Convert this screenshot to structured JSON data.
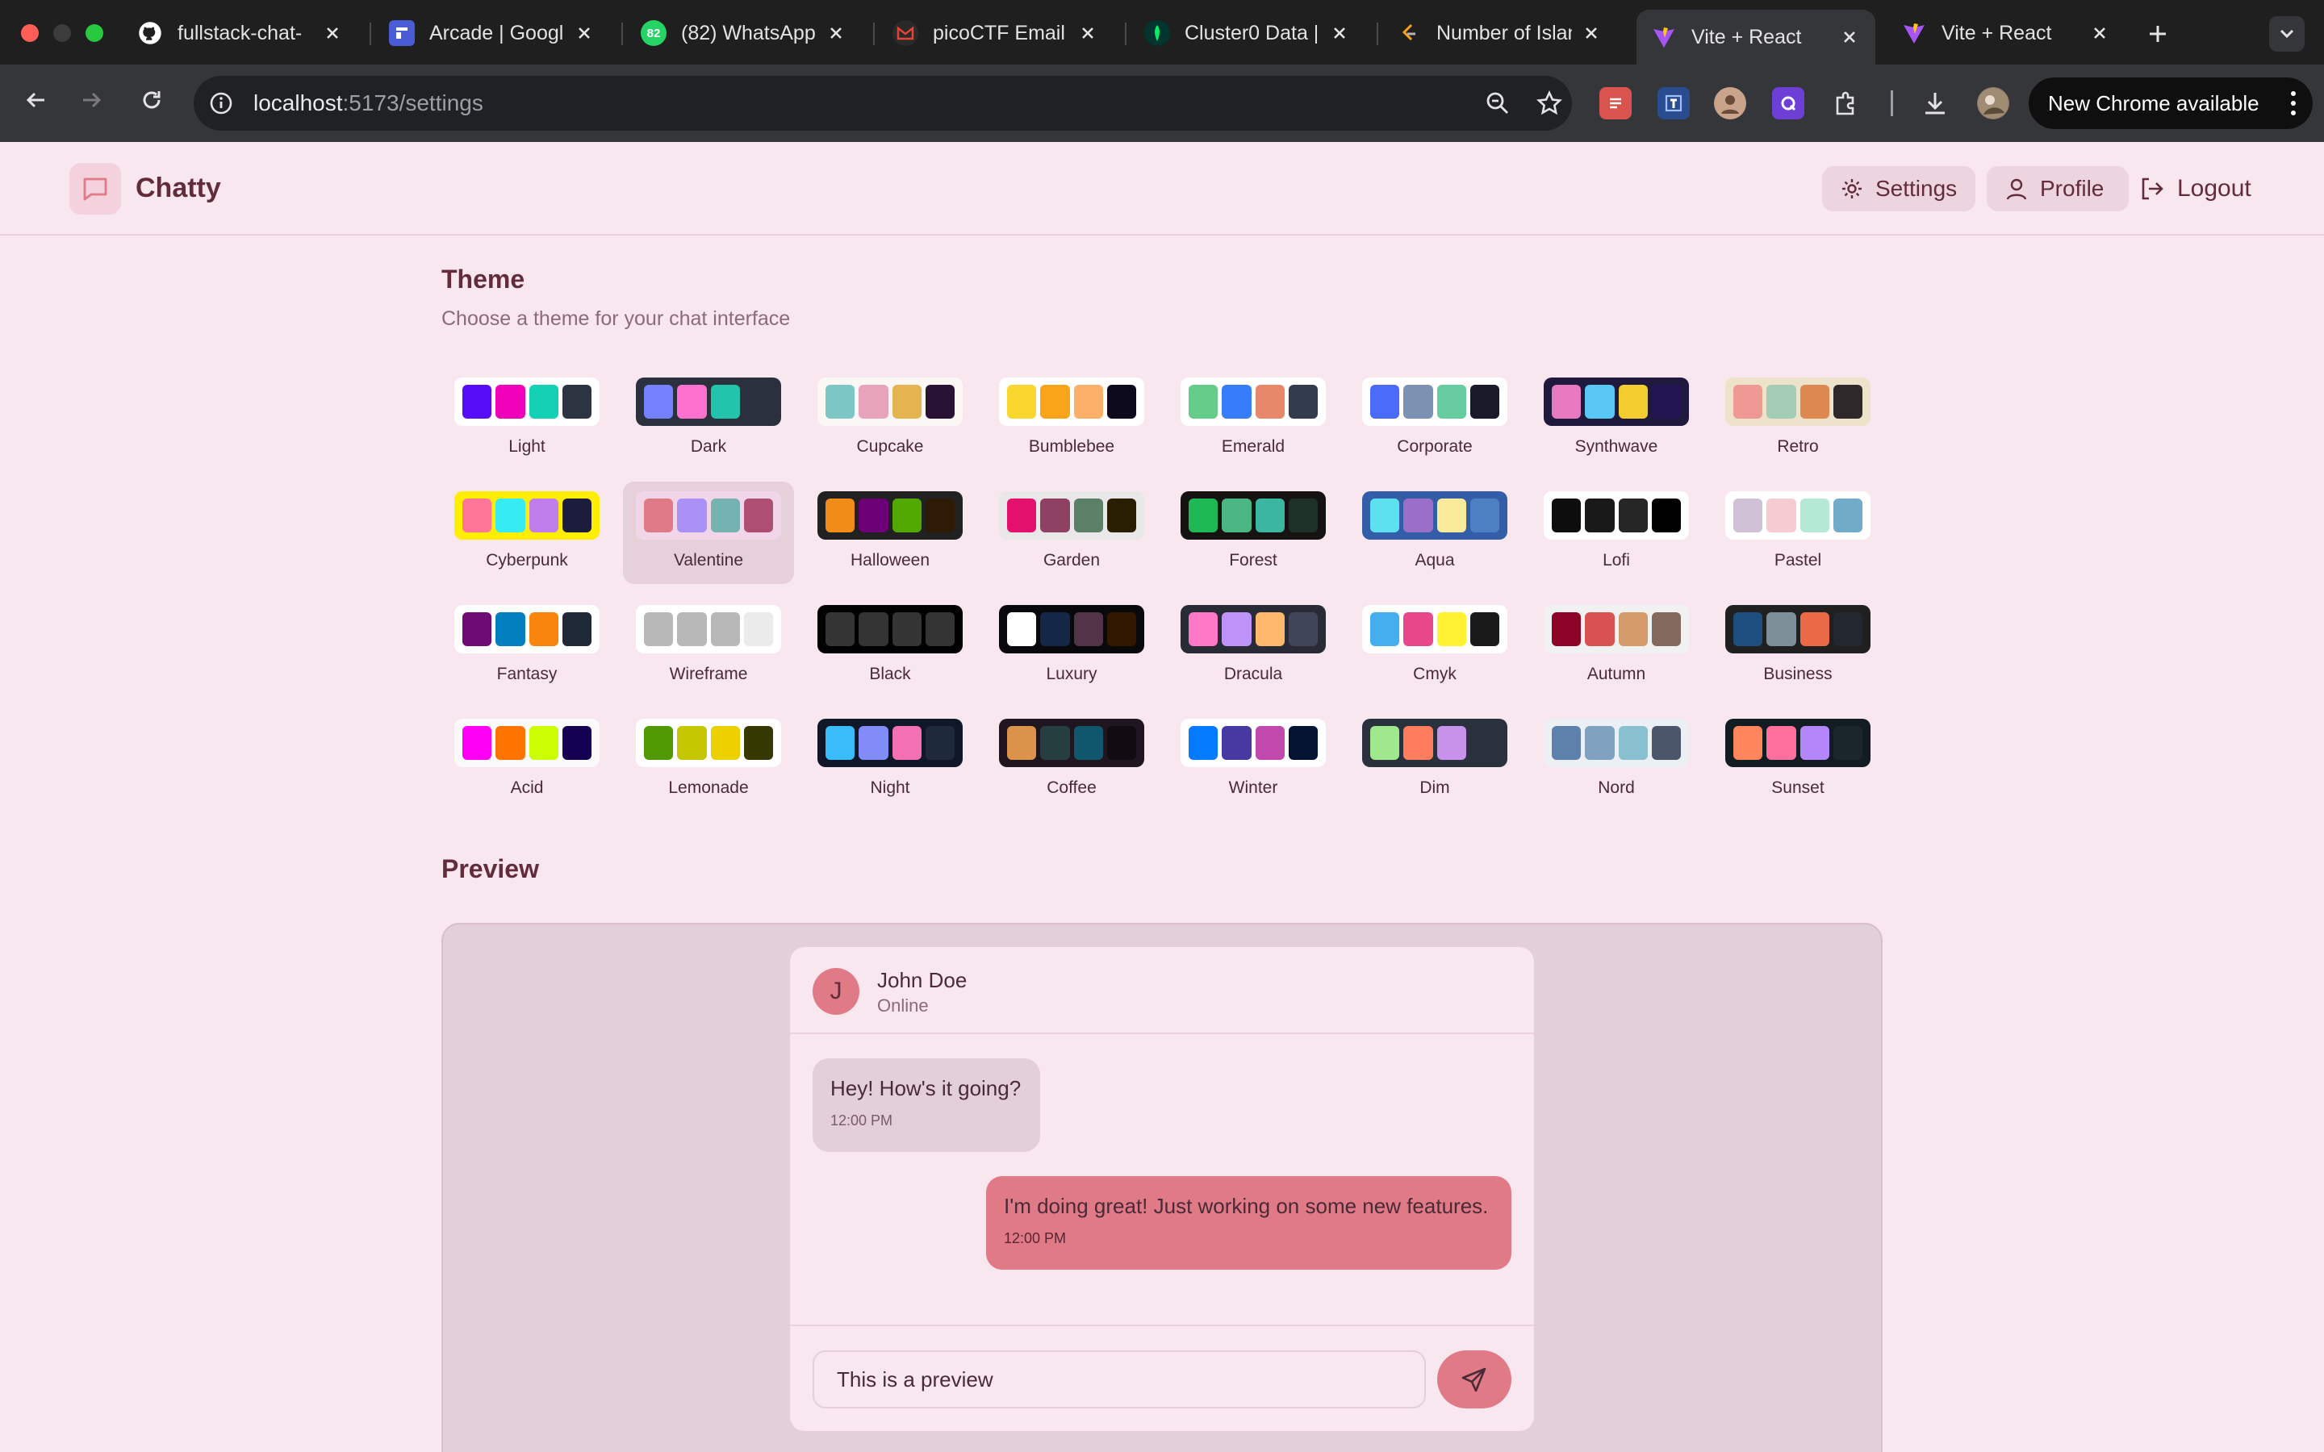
{
  "browser": {
    "tabs": [
      {
        "title": "fullstack-chat-",
        "icon": "github-icon",
        "favicon_color": "#1f1f1f"
      },
      {
        "title": "Arcade | Googl",
        "icon": "arcade-icon",
        "favicon_color": "#4a5bd6"
      },
      {
        "title": "(82) WhatsApp",
        "icon": "whatsapp-icon",
        "favicon_color": "#25d366",
        "badge": "82"
      },
      {
        "title": "picoCTF Email",
        "icon": "gmail-icon",
        "favicon_color": "#ea4335"
      },
      {
        "title": "Cluster0 Data |",
        "icon": "mongodb-icon",
        "favicon_color": "#00ed64"
      },
      {
        "title": "Number of Islan",
        "icon": "leetcode-icon",
        "favicon_color": "#ffa116"
      },
      {
        "title": "Vite + React",
        "icon": "vite-icon",
        "favicon_color": "#a855f7",
        "active": true
      },
      {
        "title": "Vite + React",
        "icon": "vite-icon",
        "favicon_color": "#a855f7"
      }
    ],
    "url_host": "localhost",
    "url_path": ":5173/settings",
    "update_label": "New Chrome available"
  },
  "app": {
    "name": "Chatty",
    "nav": {
      "settings": "Settings",
      "profile": "Profile",
      "logout": "Logout"
    }
  },
  "theme_section": {
    "title": "Theme",
    "subtitle": "Choose a theme for your chat interface",
    "selected": "Valentine",
    "themes": [
      {
        "name": "Light",
        "bg": "#ffffff",
        "colors": [
          "#570df8",
          "#f000b8",
          "#14d1b5",
          "#2b3440"
        ]
      },
      {
        "name": "Dark",
        "bg": "#2a303c",
        "colors": [
          "#7582ff",
          "#ff71cf",
          "#22c4ab",
          "#2a303c"
        ]
      },
      {
        "name": "Cupcake",
        "bg": "#faf7f5",
        "colors": [
          "#7cc6c6",
          "#e7a3ba",
          "#e5b451",
          "#291334"
        ]
      },
      {
        "name": "Bumblebee",
        "bg": "#ffffff",
        "colors": [
          "#f9d72f",
          "#faa41a",
          "#fdb06a",
          "#0d0a1e"
        ]
      },
      {
        "name": "Emerald",
        "bg": "#ffffff",
        "colors": [
          "#66cc8a",
          "#377cfb",
          "#e8886b",
          "#333c4d"
        ]
      },
      {
        "name": "Corporate",
        "bg": "#ffffff",
        "colors": [
          "#4b6bfb",
          "#7b92b2",
          "#67cba0",
          "#181a2a"
        ]
      },
      {
        "name": "Synthwave",
        "bg": "#1f1a3d",
        "colors": [
          "#e779c1",
          "#58c7f3",
          "#f3cc30",
          "#221551"
        ]
      },
      {
        "name": "Retro",
        "bg": "#ece3ca",
        "colors": [
          "#ef9995",
          "#a4cbb4",
          "#dc8850",
          "#2e282a"
        ]
      },
      {
        "name": "Cyberpunk",
        "bg": "#ffee00",
        "colors": [
          "#ff7598",
          "#37ebf3",
          "#c07eec",
          "#1c1c3c"
        ]
      },
      {
        "name": "Valentine",
        "bg": "#f0d6e8",
        "colors": [
          "#e07a86",
          "#a991f7",
          "#75b2b2",
          "#ad4e72"
        ]
      },
      {
        "name": "Halloween",
        "bg": "#212121",
        "colors": [
          "#f28c18",
          "#6d0076",
          "#51a800",
          "#2f1b05"
        ]
      },
      {
        "name": "Garden",
        "bg": "#e9e7e7",
        "colors": [
          "#e4106d",
          "#8e4162",
          "#5c7f67",
          "#291e00"
        ]
      },
      {
        "name": "Forest",
        "bg": "#171212",
        "colors": [
          "#1eb854",
          "#4ab783",
          "#3bb6a1",
          "#1d3128"
        ]
      },
      {
        "name": "Aqua",
        "bg": "#345da7",
        "colors": [
          "#5de0f0",
          "#9b6fc9",
          "#faeb9b",
          "#4c80c3"
        ]
      },
      {
        "name": "Lofi",
        "bg": "#ffffff",
        "colors": [
          "#0d0d0d",
          "#1a1919",
          "#262626",
          "#000000"
        ]
      },
      {
        "name": "Pastel",
        "bg": "#ffffff",
        "colors": [
          "#d1c1d7",
          "#f6cbd1",
          "#b4e9d6",
          "#70acc7"
        ]
      },
      {
        "name": "Fantasy",
        "bg": "#ffffff",
        "colors": [
          "#6e0b75",
          "#007ebd",
          "#f8860d",
          "#1f2937"
        ]
      },
      {
        "name": "Wireframe",
        "bg": "#ffffff",
        "colors": [
          "#b8b8b8",
          "#b8b8b8",
          "#b8b8b8",
          "#ebebeb"
        ]
      },
      {
        "name": "Black",
        "bg": "#000000",
        "colors": [
          "#343434",
          "#343434",
          "#343434",
          "#343434"
        ]
      },
      {
        "name": "Luxury",
        "bg": "#09090b",
        "colors": [
          "#ffffff",
          "#152747",
          "#513448",
          "#331800"
        ]
      },
      {
        "name": "Dracula",
        "bg": "#282a36",
        "colors": [
          "#ff79c6",
          "#bd93f9",
          "#ffb86c",
          "#414558"
        ]
      },
      {
        "name": "Cmyk",
        "bg": "#ffffff",
        "colors": [
          "#45aeee",
          "#e8488a",
          "#fff232",
          "#1a1a1a"
        ]
      },
      {
        "name": "Autumn",
        "bg": "#f1f1f1",
        "colors": [
          "#8c0327",
          "#d85251",
          "#d59b6a",
          "#826a5c"
        ]
      },
      {
        "name": "Business",
        "bg": "#202020",
        "colors": [
          "#1c4e80",
          "#7c909a",
          "#ea6947",
          "#23282e"
        ]
      },
      {
        "name": "Acid",
        "bg": "#fafafa",
        "colors": [
          "#ff00f4",
          "#ff7400",
          "#cbfd03",
          "#140151"
        ]
      },
      {
        "name": "Lemonade",
        "bg": "#ffffff",
        "colors": [
          "#519903",
          "#c5c800",
          "#edd000",
          "#353900"
        ]
      },
      {
        "name": "Night",
        "bg": "#0f1729",
        "colors": [
          "#38bdf8",
          "#818cf8",
          "#f471b5",
          "#1e293b"
        ]
      },
      {
        "name": "Coffee",
        "bg": "#20161f",
        "colors": [
          "#db924b",
          "#263e3f",
          "#10576d",
          "#120c12"
        ]
      },
      {
        "name": "Winter",
        "bg": "#ffffff",
        "colors": [
          "#047aff",
          "#463aa2",
          "#c148ac",
          "#021431"
        ]
      },
      {
        "name": "Dim",
        "bg": "#2a303c",
        "colors": [
          "#9fe88d",
          "#ff7d5c",
          "#c792e9",
          "#2a303c"
        ]
      },
      {
        "name": "Nord",
        "bg": "#eceff4",
        "colors": [
          "#5e81ac",
          "#81a1c1",
          "#88c0d0",
          "#4c566a"
        ]
      },
      {
        "name": "Sunset",
        "bg": "#121c22",
        "colors": [
          "#ff865b",
          "#fd6f9c",
          "#b387fa",
          "#1b262c"
        ]
      }
    ]
  },
  "preview": {
    "title": "Preview",
    "contact": {
      "initial": "J",
      "name": "John Doe",
      "status": "Online"
    },
    "messages": [
      {
        "text": "Hey! How's it going?",
        "time": "12:00 PM",
        "sent": false
      },
      {
        "text": "I'm doing great! Just working on some new features.",
        "time": "12:00 PM",
        "sent": true
      }
    ],
    "input_value": "This is a preview"
  },
  "colors": {
    "accent": "#e07a86",
    "text": "#632c3b",
    "page_bg": "#f9e7f0"
  }
}
